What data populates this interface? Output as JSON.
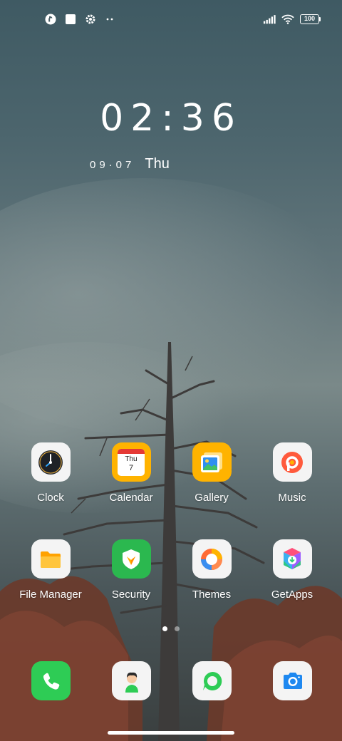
{
  "status_bar": {
    "battery": "100",
    "left_icons": [
      "app-notification-icon",
      "square-notification-icon",
      "settings-notification-icon",
      "more-notifications-icon"
    ],
    "right_icons": [
      "signal-icon",
      "wifi-icon",
      "battery-icon"
    ]
  },
  "clock_widget": {
    "time": "02:36",
    "date": "09·07",
    "weekday": "Thu"
  },
  "apps": [
    {
      "label": "Clock",
      "icon": "clock-icon"
    },
    {
      "label": "Calendar",
      "icon": "calendar-icon",
      "calendar_day": "Thu",
      "calendar_date": "7"
    },
    {
      "label": "Gallery",
      "icon": "gallery-icon"
    },
    {
      "label": "Music",
      "icon": "music-icon"
    },
    {
      "label": "File Manager",
      "icon": "folder-icon"
    },
    {
      "label": "Security",
      "icon": "shield-icon"
    },
    {
      "label": "Themes",
      "icon": "themes-icon"
    },
    {
      "label": "GetApps",
      "icon": "getapps-icon"
    }
  ],
  "page_indicator": {
    "pages": 2,
    "active": 1
  },
  "dock": [
    {
      "icon": "phone-icon"
    },
    {
      "icon": "contacts-icon"
    },
    {
      "icon": "messages-icon"
    },
    {
      "icon": "camera-icon"
    }
  ],
  "colors": {
    "phone": "#2ecc55",
    "security": "#2bb84f",
    "calendar": "#ffb300",
    "gallery": "#ffb300",
    "music": "#ff5a3c",
    "getapps": "#3ab0f0",
    "camera": "#1e88f0"
  }
}
